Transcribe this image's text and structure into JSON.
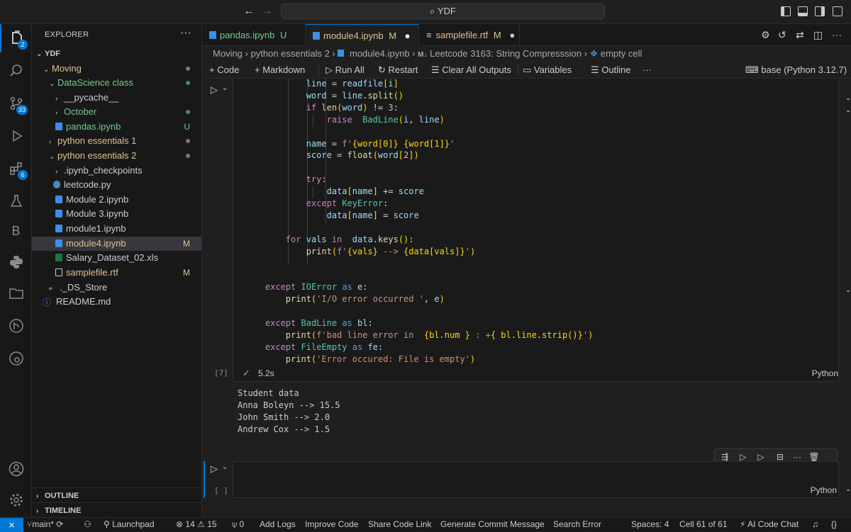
{
  "titlebar": {
    "search": "YDF"
  },
  "activity": {
    "explorer_badge": "2",
    "scm_badge": "33",
    "extensions_badge": "6",
    "b_label": "B"
  },
  "sidebar": {
    "title": "EXPLORER",
    "root": "YDF",
    "items": [
      {
        "label": "Moving",
        "type": "folder"
      },
      {
        "label": "DataScience class",
        "type": "folder"
      },
      {
        "label": "__pycache__",
        "type": "folder"
      },
      {
        "label": "October",
        "type": "folder"
      },
      {
        "label": "pandas.ipynb",
        "type": "notebook",
        "status": "U"
      },
      {
        "label": "python essentials 1",
        "type": "folder"
      },
      {
        "label": "python essentials 2",
        "type": "folder"
      },
      {
        "label": ".ipynb_checkpoints",
        "type": "folder"
      },
      {
        "label": "leetcode.py",
        "type": "python"
      },
      {
        "label": "Module 2.ipynb",
        "type": "notebook"
      },
      {
        "label": "Module 3.ipynb",
        "type": "notebook"
      },
      {
        "label": "module1.ipynb",
        "type": "notebook"
      },
      {
        "label": "module4.ipynb",
        "type": "notebook",
        "status": "M"
      },
      {
        "label": "Salary_Dataset_02.xls",
        "type": "excel"
      },
      {
        "label": "samplefile.rtf",
        "type": "text",
        "status": "M"
      },
      {
        "label": "._DS_Store",
        "type": "link"
      },
      {
        "label": "README.md",
        "type": "info"
      }
    ],
    "outline": "OUTLINE",
    "timeline": "TIMELINE"
  },
  "tabs": [
    {
      "label": "pandas.ipynb",
      "status": "U"
    },
    {
      "label": "module4.ipynb",
      "status": "M"
    },
    {
      "label": "samplefile.rtf",
      "status": "M"
    }
  ],
  "breadcrumb": {
    "b1": "Moving",
    "b2": "python essentials 2",
    "b3": "module4.ipynb",
    "b4_prefix": "M↓",
    "b4": "Leetcode 3163: String Compresssion",
    "b5": "empty cell"
  },
  "toolbar": {
    "code": "Code",
    "markdown": "Markdown",
    "run_all": "Run All",
    "restart": "Restart",
    "clear": "Clear All Outputs",
    "variables": "Variables",
    "outline": "Outline",
    "more": "···",
    "kernel": "base (Python 3.12.7)"
  },
  "cell1": {
    "exec_count": "[7]",
    "duration": "5.2s",
    "language": "Python",
    "lines": [
      "            line = readfile[i]",
      "            word = line.split()",
      "            if len(word) != 3:",
      "                raise  BadLine(i, line)",
      "",
      "            name = f'{word[0]} {word[1]}'",
      "            score = float(word[2])",
      "",
      "            try:",
      "                data[name] += score",
      "            except KeyError:",
      "                data[name] = score",
      "",
      "        for vals in  data.keys():",
      "            print(f'{vals} --> {data[vals]}')",
      "",
      "",
      "    except IOError as e:",
      "        print('I/O error occurred ', e)",
      "",
      "    except BadLine as bl:",
      "        print(f'bad line error in  {bl.num } : +{ bl.line.strip()}')",
      "    except FileEmpty as fe:",
      "        print('Error occured: File is empty')"
    ]
  },
  "output": {
    "lines": [
      "Student data",
      "Anna Boleyn --> 15.5",
      "John Smith --> 2.0",
      "Andrew Cox --> 1.5"
    ]
  },
  "cell2": {
    "exec_count": "[ ]",
    "language": "Python"
  },
  "statusbar": {
    "branch": "main*",
    "launchpad": "Launchpad",
    "errors": "14",
    "warnings": "15",
    "ports": "0",
    "add_logs": "Add Logs",
    "improve": "Improve Code",
    "share": "Share Code Link",
    "commit": "Generate Commit Message",
    "search_error": "Search Error",
    "spaces": "Spaces: 4",
    "cell": "Cell 61 of 61",
    "ai_chat": "AI Code Chat",
    "braces": "{}"
  },
  "colors": {
    "accent": "#0078d4",
    "modified": "#e2c08d",
    "untracked": "#73c991",
    "background": "#1f1f1f"
  }
}
